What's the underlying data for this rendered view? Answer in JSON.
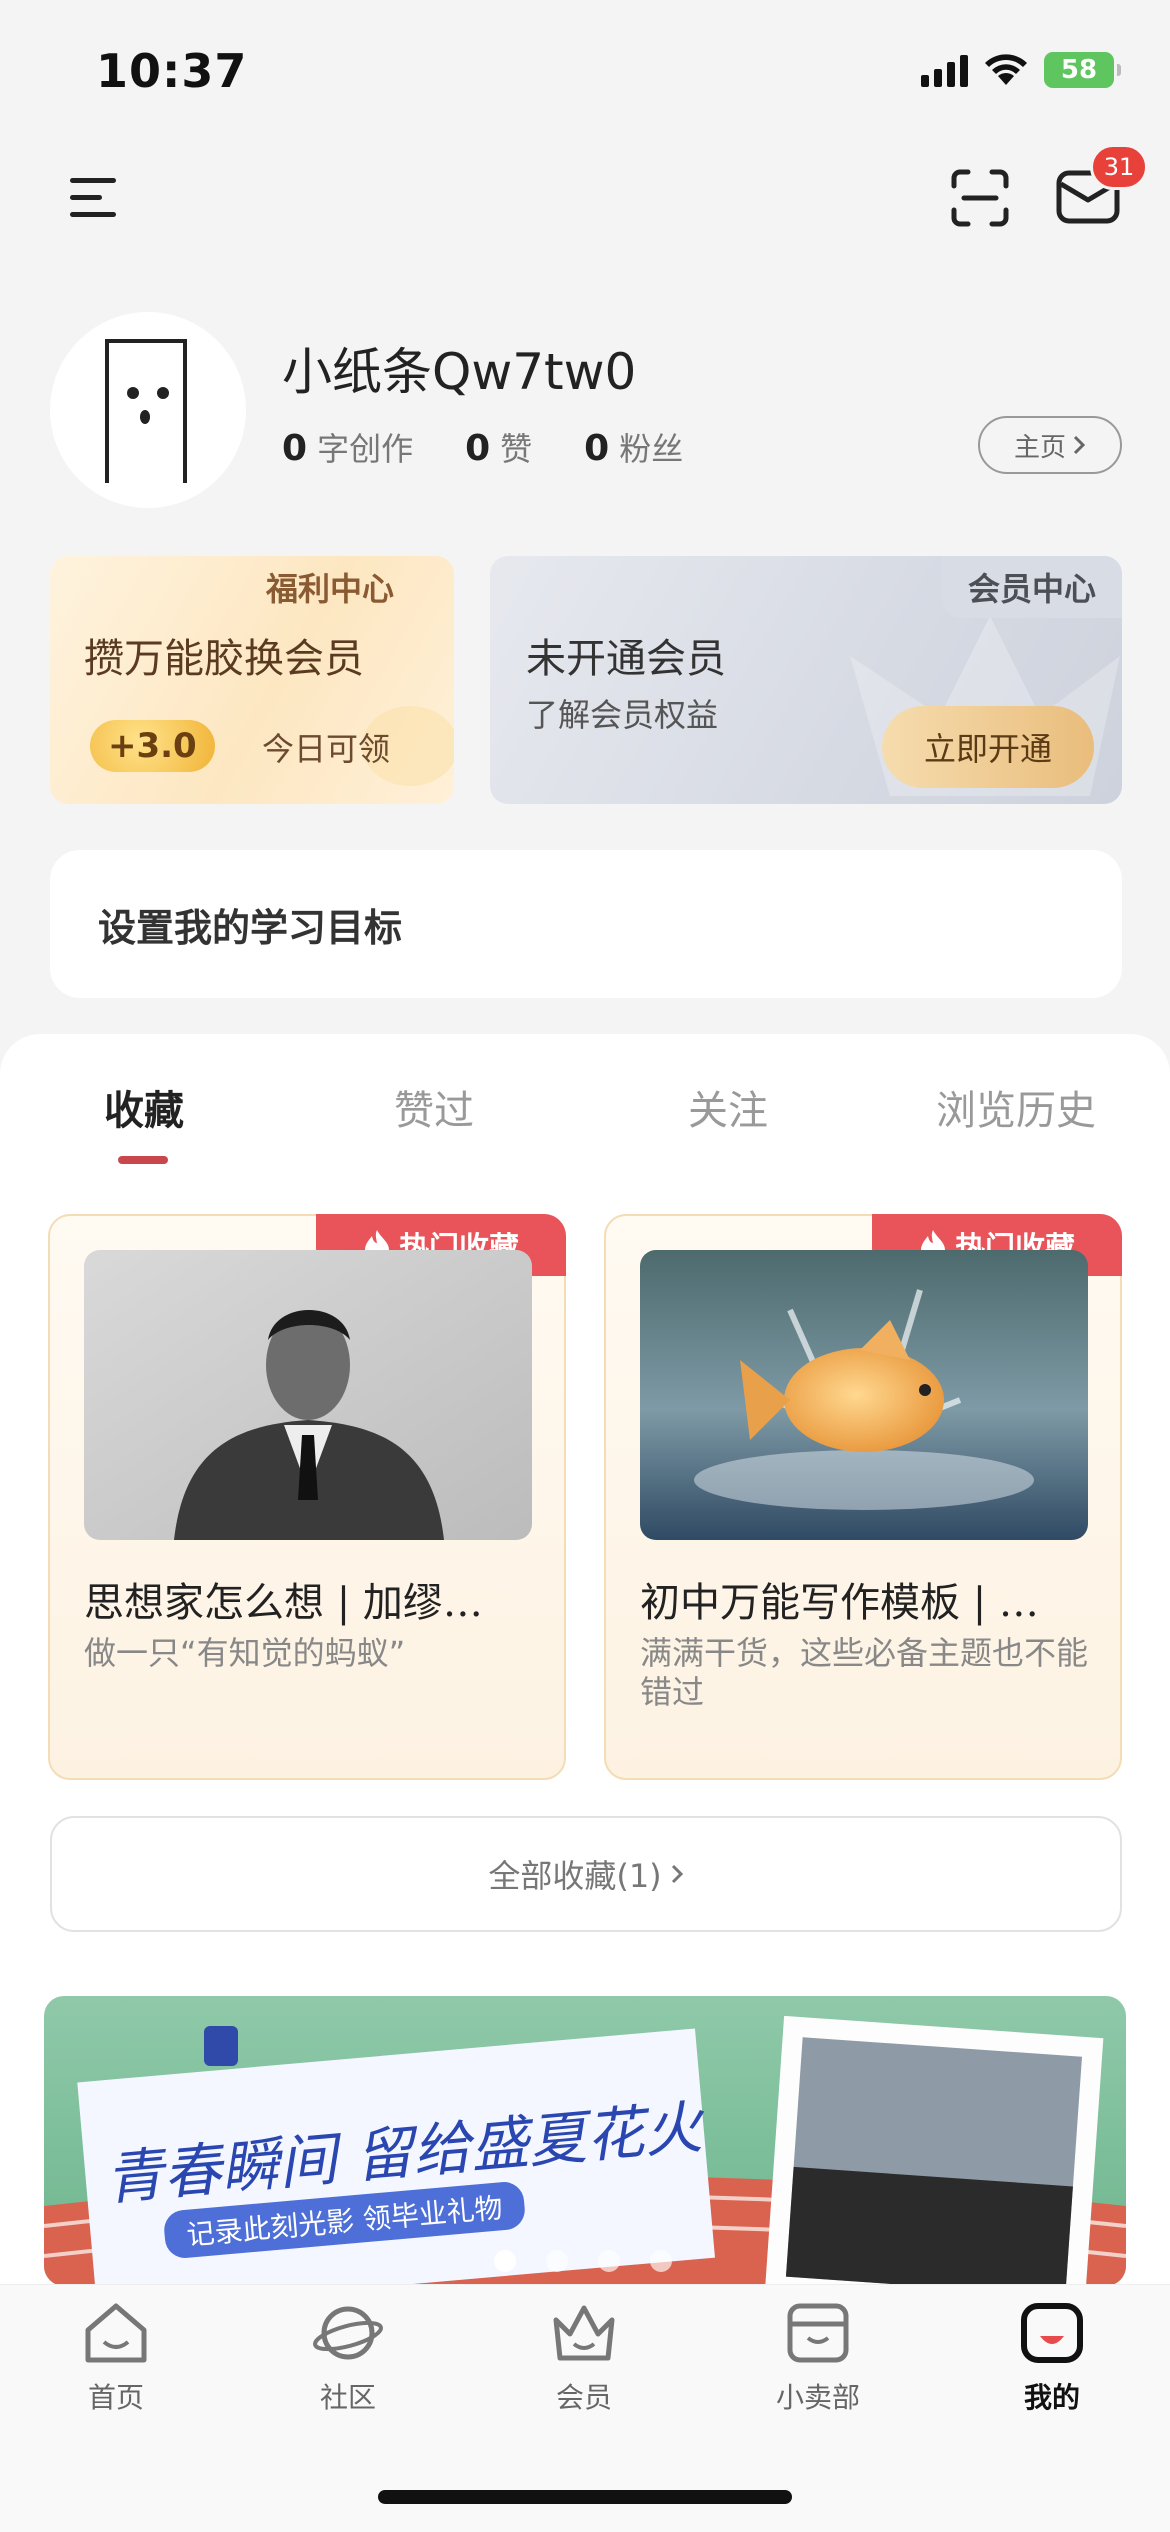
{
  "status_bar": {
    "time": "10:37",
    "battery": "58"
  },
  "header": {
    "mail_badge": "31"
  },
  "profile": {
    "username": "小纸条Qw7tw0",
    "stats": [
      {
        "value": "0",
        "label": "字创作"
      },
      {
        "value": "0",
        "label": "赞"
      },
      {
        "value": "0",
        "label": "粉丝"
      }
    ],
    "home_label": "主页"
  },
  "welfare": {
    "tag": "福利中心",
    "title": "攒万能胶换会员",
    "coins": "+3.0",
    "today": "今日可领"
  },
  "member": {
    "tag": "会员中心",
    "title": "未开通会员",
    "subtitle": "了解会员权益",
    "button": "立即开通"
  },
  "goal": {
    "label": "设置我的学习目标"
  },
  "tabs": [
    "收藏",
    "赞过",
    "关注",
    "浏览历史"
  ],
  "favorites": [
    {
      "badge": "热门收藏",
      "title": "思想家怎么想 | 加缪…",
      "desc": "做一只“有知觉的蚂蚁”"
    },
    {
      "badge": "热门收藏",
      "title": "初中万能写作模板 | …",
      "desc": "满满干货，这些必备主题也不能错过"
    }
  ],
  "all_favorites": "全部收藏(1)",
  "banner": {
    "headline": "青春瞬间 留给盛夏花火",
    "sub": "记录此刻光影  领毕业礼物"
  },
  "nav": [
    {
      "label": "首页"
    },
    {
      "label": "社区"
    },
    {
      "label": "会员"
    },
    {
      "label": "小卖部"
    },
    {
      "label": "我的"
    }
  ]
}
